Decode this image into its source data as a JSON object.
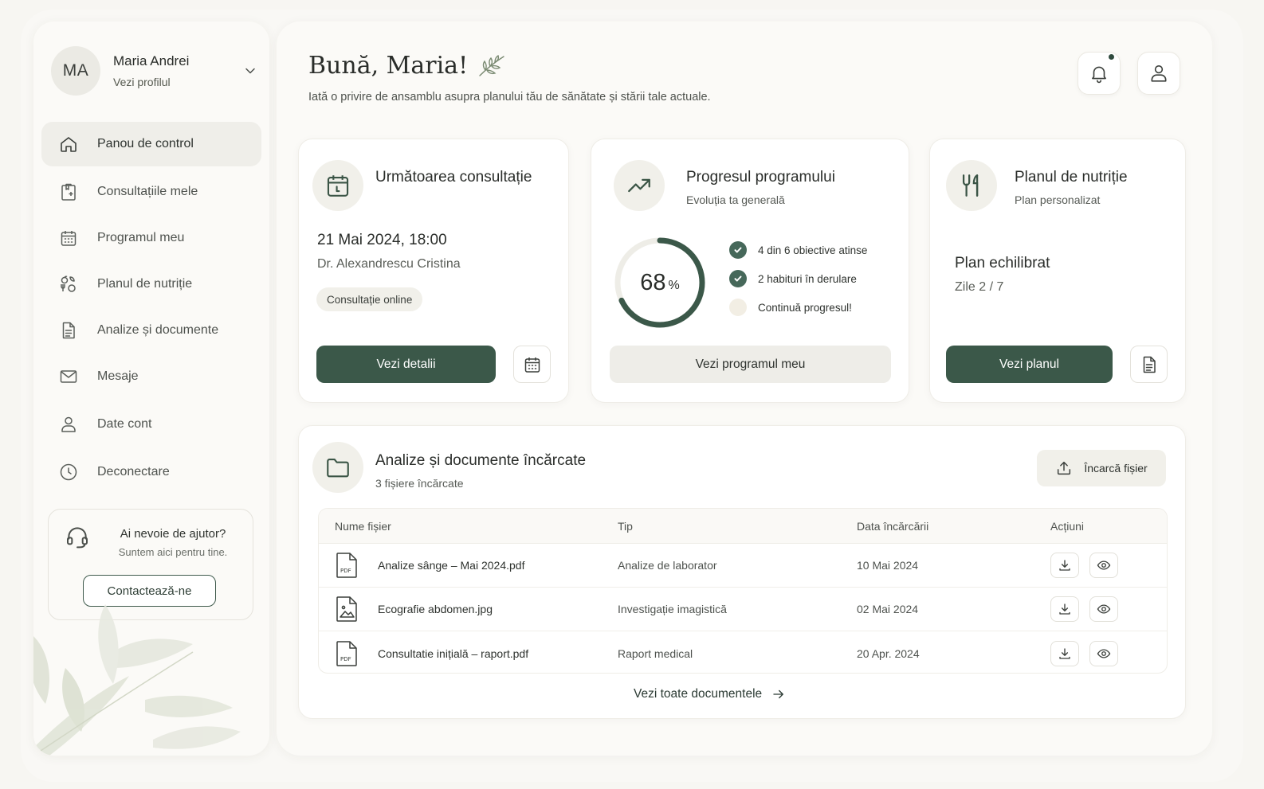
{
  "sidebar": {
    "profile": {
      "initials": "MA",
      "name": "Maria Andrei",
      "link": "Vezi profilul"
    },
    "nav": [
      {
        "label": "Panou de control",
        "icon": "home-icon",
        "active": true
      },
      {
        "label": "Consultațiile mele",
        "icon": "clipboard-icon"
      },
      {
        "label": "Programul meu",
        "icon": "calendar-icon"
      },
      {
        "label": "Planul de nutriție",
        "icon": "nutrition-icon"
      },
      {
        "label": "Analize și documente",
        "icon": "document-icon"
      },
      {
        "label": "Mesaje",
        "icon": "mail-icon"
      },
      {
        "label": "Date cont",
        "icon": "user-icon"
      },
      {
        "label": "Deconectare",
        "icon": "logout-icon"
      }
    ],
    "help": {
      "title": "Ai nevoie de ajutor?",
      "subtitle": "Suntem aici pentru tine.",
      "button": "Contactează-ne"
    }
  },
  "header": {
    "greeting": "Bună, Maria!",
    "subtitle": "Iată o privire de ansamblu asupra planului tău de sănătate și stării tale actuale."
  },
  "cards": {
    "consultation": {
      "title": "Următoarea consultație",
      "datetime": "21 Mai 2024, 18:00",
      "doctor": "Dr. Alexandrescu Cristina",
      "badge": "Consultație online",
      "button": "Vezi detalii"
    },
    "progress": {
      "title": "Progresul programului",
      "subtitle": "Evoluția ta generală",
      "percent_value": "68",
      "percent_sign": "%",
      "fraction": 0.68,
      "goals": [
        {
          "text": "4 din 6 obiective atinse",
          "done": true
        },
        {
          "text": "2 habituri în derulare",
          "done": true
        },
        {
          "text": "Continuă progresul!",
          "done": false
        }
      ],
      "button": "Vezi programul meu"
    },
    "nutrition": {
      "title": "Planul de nutriție",
      "subtitle": "Plan personalizat",
      "plan": "Plan echilibrat",
      "days": "Zile 2 / 7",
      "button": "Vezi planul"
    }
  },
  "documents": {
    "title": "Analize și documente încărcate",
    "subtitle": "3 fișiere încărcate",
    "upload": "Încarcă fișier",
    "columns": [
      "Nume fișier",
      "Tip",
      "Data încărcării",
      "Acțiuni"
    ],
    "rows": [
      {
        "name": "Analize sânge – Mai 2024.pdf",
        "type": "Analize de laborator",
        "date": "10 Mai 2024",
        "icon": "pdf-file-icon"
      },
      {
        "name": "Ecografie abdomen.jpg",
        "type": "Investigație imagistică",
        "date": "02 Mai 2024",
        "icon": "image-file-icon"
      },
      {
        "name": "Consultatie inițială – raport.pdf",
        "type": "Raport medical",
        "date": "20 Apr. 2024",
        "icon": "pdf-file-icon"
      }
    ],
    "view_all": "Vezi toate documentele"
  },
  "colors": {
    "accent": "#3b5849",
    "accent_light": "#f1f0ea",
    "background": "#f7f6f2"
  }
}
